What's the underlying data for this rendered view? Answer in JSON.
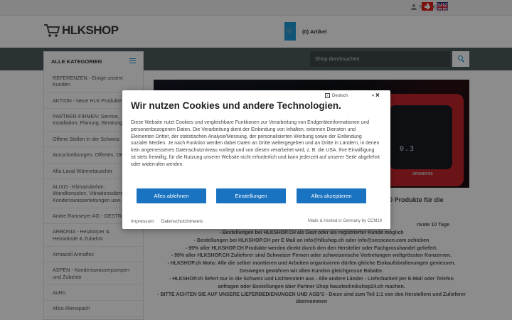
{
  "topbar": {
    "account_label": "Mein Konto",
    "flags": [
      "swiss-flag-icon",
      "uk-flag-icon"
    ]
  },
  "header": {
    "logo_text": "HLKSHOP",
    "cart_label": "(0) Artikel"
  },
  "nav": {
    "categories_title": "ALLE KATEGORIEN",
    "search_placeholder": "Shop durchsuchen"
  },
  "sidebar": {
    "items": [
      {
        "label": "REFERENZEN - Einige unsere Kunden"
      },
      {
        "label": "AKTION - Neue HLK Produkte"
      },
      {
        "label": "PARTNER-FIRMEN: Service, Installation, Planung, Beratung"
      },
      {
        "label": "Offene Stellen in der Schweiz"
      },
      {
        "label": "Ausschreibungen, Offerten, De"
      },
      {
        "label": "Alfa Laval Wärmetauscher"
      },
      {
        "label": "ALIXO - Klimazubehör, Wandkonsolen, Vibrationsdämpfer, Kondenswasserleitungen usw."
      },
      {
        "label": "Andre Ramseyer AG - GESTRA"
      },
      {
        "label": "ARBONIA - Heizkörper & Heizwände & Zubehör"
      },
      {
        "label": "Armacell Armaflex"
      },
      {
        "label": "ASPEN - Kondenswasserpumpen und Zubehör"
      },
      {
        "label": "AuRü"
      },
      {
        "label": "Allco Allenspach"
      }
    ]
  },
  "hero": {
    "display_value": "0.3",
    "brand": "GRUNDFOS"
  },
  "main": {
    "heading": "100'000 Produkte für die\nchnik",
    "bullets": [
      "rivate 10 Tage",
      "- Bestellungen bei HLKSHOP.CH als Gast oder als registrierter Kunde möglich",
      "- Bestellungen bei HLKSHOP.CH per E Mail an info@hlkshop.ch oder info@secococn.com schicken",
      "- 99% aller HLKSHOP.CH Produkte werden direkt durch den den Hersteller oder Fachgrosshandel geliefert.",
      "- 99% aller HLKSHOP.CH Zulieferer sind Schweizer Firmen oder schweizerische Vertretungen weltgrössten Konzernen.",
      "- HLKSHOP.ch Moto: Alle die selber montieren und Arbeiten organisieren dürfen gleiche Einkaufsbedienungen geniessen.",
      "Deswegen gewähren wir allen Kunden gleichgrosse Rabatte.",
      "- HLKSHOP.ch liefert nur in die Schweiz und Lichtenstein aus - Alle andere Länder - Lieferbarkeit per E-Mail oder Telefon",
      "anfragen oder Bestellungen über Partner Shop haustechnikshop24.ch machen.",
      "- BITTE ACHTEN SIE AUF UNSERE LIEFERBEDIENUNGEN UND AGB'S - Diese sind zum Teil 1:1 von den Herstellern und Zulieferer",
      "übernommen"
    ]
  },
  "cookie_modal": {
    "language": "Deutsch",
    "title": "Wir nutzen Cookies und andere Technologien.",
    "body": "Diese Website nutzt Cookies und vergleichbare Funktionen zur Verarbeitung von Endgeräteinformationen und personenbezogenen Daten. Die Verarbeitung dient der Einbindung von Inhalten, externen Diensten und Elementen Dritter, der statistischen Analyse/Messung, der personalisierten Werbung sowie der Einbindung sozialer Medien. Je nach Funktion werden dabei Daten an Dritte weitergegeben und an Dritte in Ländern, in denen kein angemessenes Datenschutzniveau vorliegt und von diesen verarbeitet wird, z. B. die USA. Ihre Einwilligung ist stets freiwillig, für die Nutzung unserer Website nicht erforderlich und kann jederzeit auf unserer Seite abgelehnt oder widerrufen werden.",
    "reject_label": "Alles ablehnen",
    "settings_label": "Einstellungen",
    "accept_label": "Alles akzeptieren",
    "imprint_label": "Impressum",
    "privacy_label": "Datenschutzhinweis",
    "hosted_label": "Made & Hosted in Germany by CCM19"
  },
  "colors": {
    "accent": "#1e9bd7",
    "button_blue": "#1a73c0",
    "navbar": "#4f5c60"
  }
}
